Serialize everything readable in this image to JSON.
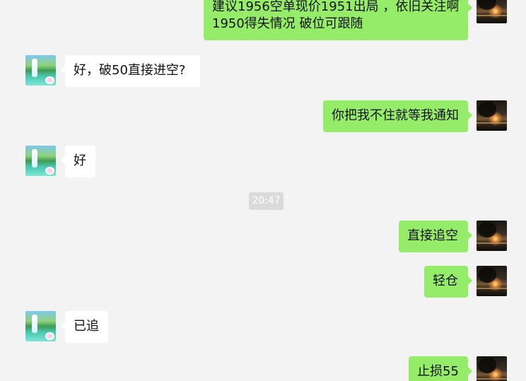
{
  "messages": [
    {
      "sender": "self",
      "lines": [
        "建议1956空单现价1951出局 ，依旧关注啊",
        "1950得失情况  破位可跟随"
      ]
    },
    {
      "sender": "other",
      "lines": [
        "好，破50直接进空?"
      ]
    },
    {
      "sender": "self",
      "lines": [
        "你把我不住就等我通知"
      ]
    },
    {
      "sender": "other",
      "lines": [
        "好"
      ]
    },
    {
      "sender": "time",
      "lines": [
        "20:47"
      ]
    },
    {
      "sender": "self",
      "lines": [
        "直接追空"
      ]
    },
    {
      "sender": "self",
      "lines": [
        "轻仓"
      ]
    },
    {
      "sender": "other",
      "lines": [
        "已追"
      ]
    },
    {
      "sender": "self",
      "lines": [
        "止损55"
      ]
    }
  ],
  "colors": {
    "background": "#f3f3f3",
    "self_bubble": "#95ec69",
    "other_bubble": "#ffffff",
    "timestamp_bg": "#dadada"
  }
}
